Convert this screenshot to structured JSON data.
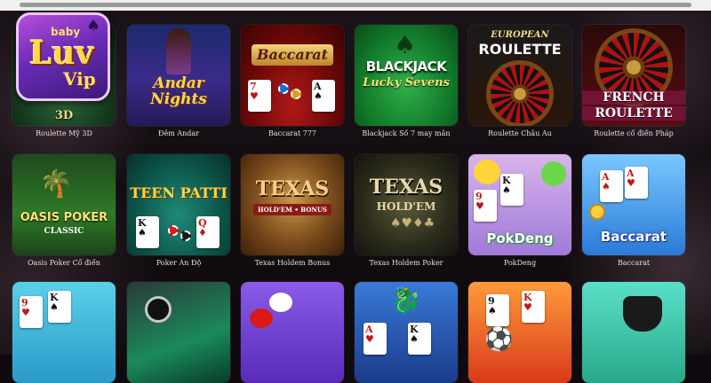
{
  "logo": {
    "small": "baby",
    "brand": "Luv",
    "sub": "Vip"
  },
  "games": [
    {
      "caption": "Roulette Mỹ 3D",
      "art": "3D"
    },
    {
      "caption": "Đêm Andar",
      "art": "Andar Nights"
    },
    {
      "caption": "Baccarat 777",
      "art": "Baccarat"
    },
    {
      "caption": "Blackjack Số 7 may mắn",
      "art": "BLACKJACK",
      "art2": "Lucky Sevens"
    },
    {
      "caption": "Roulette Châu Âu",
      "art": "EUROPEAN",
      "art2": "ROULETTE"
    },
    {
      "caption": "Roulette cổ điển Pháp",
      "art": "FRENCH",
      "art2": "ROULETTE"
    },
    {
      "caption": "Oasis Poker Cổ điển",
      "art": "OASIS POKER",
      "art2": "CLASSIC"
    },
    {
      "caption": "Poker Ấn Độ",
      "art": "TEEN PATTI"
    },
    {
      "caption": "Texas Holdem Bonus",
      "art": "TEXAS",
      "art2": "HOLD'EM • BONUS"
    },
    {
      "caption": "Texas Holdem Poker",
      "art": "TEXAS",
      "art2": "HOLD'EM"
    },
    {
      "caption": "PokDeng",
      "art": "PokDeng"
    },
    {
      "caption": "Baccarat",
      "art": "Baccarat"
    }
  ],
  "colors": {
    "caption": "#e8e0d6",
    "background": "#0f0a10"
  }
}
